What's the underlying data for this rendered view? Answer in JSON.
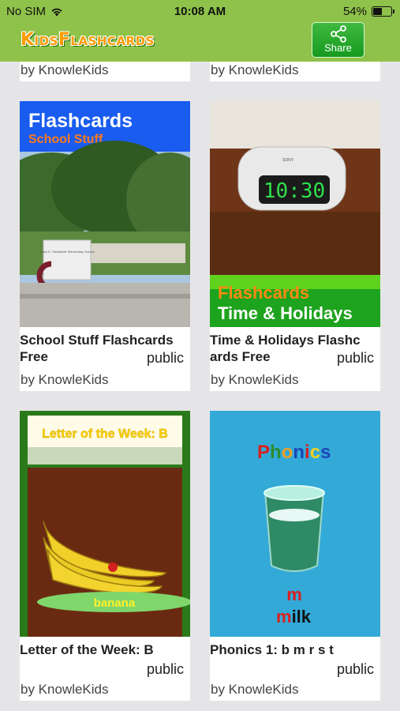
{
  "status": {
    "carrier": "No SIM",
    "time": "10:08 AM",
    "battery": "54%",
    "battery_level": 0.54
  },
  "header": {
    "logo": "KidsFlashcards",
    "share_label": "Share"
  },
  "top_row": [
    {
      "author": "by KnowleKids"
    },
    {
      "author": "by KnowleKids"
    }
  ],
  "cards": [
    {
      "title": "School Stuff Flashcards Free",
      "title_lines": [
        "School Stuff Flashcards",
        " Free"
      ],
      "visibility": "public",
      "author": "by KnowleKids",
      "thumb": {
        "heading": "Flashcards",
        "subheading": "School Stuff",
        "sign_text": "Louis E. Stocklmeir Elementary School"
      }
    },
    {
      "title": "Time & Holidays Flashcards Free",
      "title_lines": [
        "Time & Holidays Flashc",
        "ards Free"
      ],
      "visibility": "public",
      "author": "by KnowleKids",
      "thumb": {
        "clock_time": "10:30",
        "brand": "SONY",
        "heading": "Flashcards",
        "subheading": "Time & Holidays"
      }
    },
    {
      "title": "Letter of the Week: B",
      "title_lines": [
        "Letter of the Week: B",
        ""
      ],
      "visibility": "public",
      "author": "by KnowleKids",
      "thumb": {
        "heading": "Letter of the Week: B",
        "word": "banana"
      }
    },
    {
      "title": "Phonics 1: b m r s t",
      "title_lines": [
        "Phonics 1: b m r s t",
        ""
      ],
      "visibility": "public",
      "author": "by KnowleKids",
      "thumb": {
        "heading": "Phonics",
        "letter": "m",
        "word_rest": "ilk",
        "word_first": "m"
      }
    }
  ],
  "colors": {
    "header_green": "#8fc24a",
    "background": "#e5e5e7",
    "share_green": "#1fa32a",
    "logo_orange": "#ff9a00"
  }
}
